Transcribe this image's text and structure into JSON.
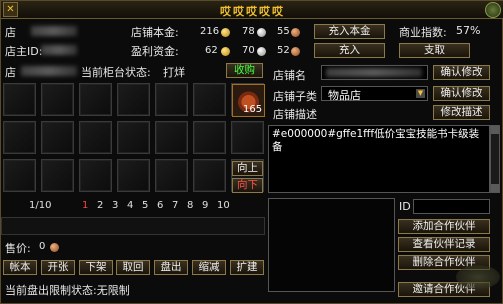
{
  "title": "哎哎哎哎哎",
  "header": {
    "shop_label": "店",
    "owner_label": "店主ID:",
    "capital_label": "店铺本金:",
    "capital_gold": "216",
    "capital_silver": "78",
    "capital_copper": "55",
    "deposit_capital_btn": "充入本金",
    "business_index_label": "商业指数:",
    "business_index_value": "57%",
    "profit_label": "盈利资金:",
    "profit_gold": "62",
    "profit_silver": "70",
    "profit_copper": "52",
    "deposit_btn": "充入",
    "withdraw_btn": "支取"
  },
  "counter": {
    "shop_prefix": "店",
    "status_label": "当前柜台状态:",
    "status_value": "打烊",
    "collect_btn": "收购",
    "up_btn": "向上",
    "down_btn": "向下",
    "item_count": "165"
  },
  "shop_info": {
    "name_label": "店铺名",
    "confirm_btn_1": "确认修改",
    "type_label": "店铺子类",
    "type_value": "物品店",
    "confirm_btn_2": "确认修改",
    "desc_label": "店铺描述",
    "confirm_btn_3": "修改描述",
    "desc_text": "#e000000#gffe1fff低价宝宝技能书卡级装备"
  },
  "pagination": {
    "page_text": "1/10",
    "pages": [
      "1",
      "2",
      "3",
      "4",
      "5",
      "6",
      "7",
      "8",
      "9",
      "10"
    ],
    "active": "1"
  },
  "partner": {
    "id_label": "ID",
    "add_btn": "添加合作伙伴",
    "view_btn": "查看伙伴记录",
    "delete_btn": "删除合作伙伴",
    "invite_btn": "邀请合作伙伴"
  },
  "price": {
    "label": "售价:",
    "value": "0"
  },
  "bottom_buttons": [
    "帐本",
    "开张",
    "下架",
    "取回",
    "盘出",
    "缩减",
    "扩建"
  ],
  "footer": {
    "limit_text": "当前盘出限制状态:无限制"
  }
}
